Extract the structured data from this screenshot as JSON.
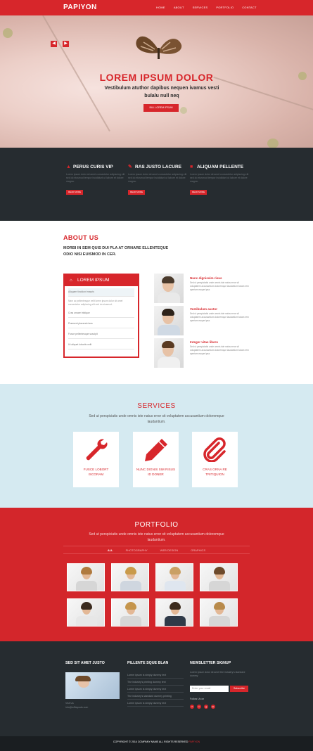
{
  "nav": {
    "brand": "PAPIYON",
    "links": [
      "HOME",
      "ABOUT",
      "SERVICES",
      "PORTFOLIO",
      "CONTACT"
    ]
  },
  "hero": {
    "title": "LOREM IPSUM DOLOR",
    "subtitle": "Vestibulum atuthor dapibus nequen ivamus vesti bulalu null neq",
    "button": "BUL LOREM IPSUM"
  },
  "features": [
    {
      "icon": "bookmark-icon",
      "title": "PERUS CURIS VIP",
      "text": "Lorem ipsum dolor sit amet consectetur adipiscing elit sed do eiusmod tempor incididunt ut labore et dolore magna.",
      "button": "READ MORE"
    },
    {
      "icon": "pencil-icon",
      "title": "RAS JUSTO LACURE",
      "text": "Lorem ipsum dolor sit amet consectetur adipiscing elit sed do eiusmod tempor incididunt ut labore et dolore magna.",
      "button": "READ MORE"
    },
    {
      "icon": "square-icon",
      "title": "ALIQUAM PELLENTE",
      "text": "Lorem ipsum dolor sit amet consectetur adipiscing elit sed do eiusmod tempor incididunt ut labore et dolore magna.",
      "button": "READ MORE"
    }
  ],
  "about": {
    "title": "ABOUT US",
    "lead": "MORBI IN SEM QUIS DUI PLA AT ORNARE ELLENTEQUE ODIO NISI EUISMOD IN CER.",
    "card": {
      "title": "LOREM IPSUM",
      "rows": [
        "Aliquam tincidunt mauris",
        "Vestibulum auctor dapibus neque",
        "Cras ornare tristique",
        "Praesent placerat risus",
        "Fusce pellentesque suscipit",
        "Ut aliquet lobortis velit"
      ],
      "text": "Nam ac pellentesque velit lorem ipsum dolor sit amet consectetur adipiscing elit sed do eiusmod."
    },
    "testimonials": [
      {
        "title": "Nunc dignissim risus",
        "text": "Sed ut perspiciatis unde omnis iste natus error sit voluptatem accusantium doloremque laudantium totam rem aperiam eaque ipsa."
      },
      {
        "title": "Vestibulum auctor",
        "text": "Sed ut perspiciatis unde omnis iste natus error sit voluptatem accusantium doloremque laudantium totam rem aperiam eaque ipsa."
      },
      {
        "title": "Integer vitae libero",
        "text": "Sed ut perspiciatis unde omnis iste natus error sit voluptatem accusantium doloremque laudantium totam rem aperiam eaque ipsa."
      }
    ]
  },
  "services": {
    "title": "SERVICES",
    "subtitle": "Sed ut perspiciatis unde omnis iste natus error sit voluptatem accusantium doloremque laudantium.",
    "items": [
      {
        "icon": "wrench-icon",
        "label": "FUSCE LOBORT ISCORAM"
      },
      {
        "icon": "pencil-icon",
        "label": "NUNC DIGNIS SIM RISUS ID DONER"
      },
      {
        "icon": "paperclip-icon",
        "label": "CRAS ORNA RE TRITIQUION"
      }
    ]
  },
  "portfolio": {
    "title": "PORTFOLIO",
    "subtitle": "Sed ut perspiciatis unde omnis iste natus error sit voluptatem accusantium doloremque laudantium.",
    "filters": [
      "ALL",
      "PHOTOGRAPHY",
      "WEB DESIGN",
      "GRAPHICS"
    ]
  },
  "footer": {
    "col1_title": "SED SIT AMET JUSTO",
    "col1_text": "Visit Us",
    "col1_email": "info@w3layouts.com",
    "col2_title": "PILLENTE SQUE BLAN",
    "links": [
      "Lorem ipsum is simply dummy text",
      "The industry's printing dummy text",
      "Lorem ipsum is simply dummy text",
      "The industry's standard dummy printing",
      "Lorem ipsum is simply dummy text"
    ],
    "col3_title": "NEWSLETTER SIGNUP",
    "col3_text": "Lorem ipsum dolor sit amet the industry's standard dummy",
    "email_placeholder": "Enter your email",
    "subscribe": "Subscribe",
    "follow": "Follow Us on",
    "social": [
      "f",
      "t",
      "g",
      "in"
    ],
    "copyright": "COPYRIGHT © 2014 COMPANY NAME ALL RIGHTS RESERVED",
    "copyright_link": "PAPIYON"
  }
}
